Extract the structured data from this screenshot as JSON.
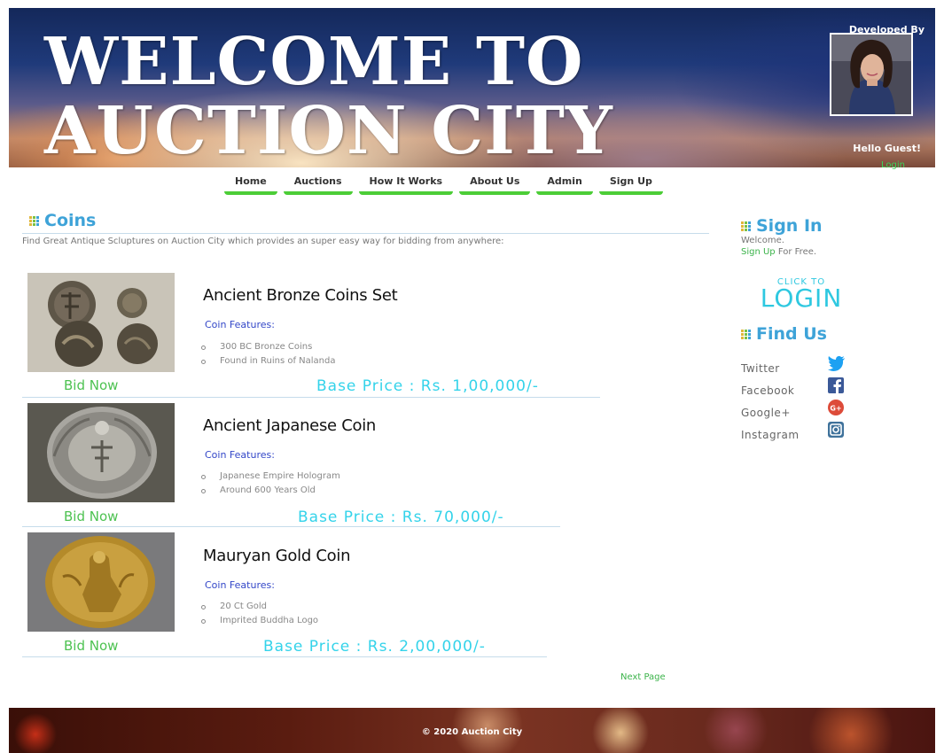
{
  "header": {
    "title_line1": "WELCOME TO",
    "title_line2": "AUCTION CITY",
    "developed_by": "Developed By",
    "greeting": "Hello Guest!",
    "login_link": "Login"
  },
  "nav": {
    "items": [
      "Home",
      "Auctions",
      "How It Works",
      "About Us",
      "Admin",
      "Sign Up"
    ]
  },
  "main": {
    "title": "Coins",
    "intro": "Find Great Antique Scluptures on Auction City which provides an super easy way for bidding from anywhere:",
    "items": [
      {
        "title": "Ancient Bronze Coins Set",
        "features_label": "Coin Features:",
        "features": [
          "300 BC Bronze Coins",
          "Found in Ruins of Nalanda"
        ],
        "bid_label": "Bid Now",
        "price": "Base Price : Rs. 1,00,000/-"
      },
      {
        "title": "Ancient Japanese Coin",
        "features_label": "Coin Features:",
        "features": [
          "Japanese Empire Hologram",
          "Around 600 Years Old"
        ],
        "bid_label": "Bid Now",
        "price": "Base Price : Rs. 70,000/-"
      },
      {
        "title": "Mauryan Gold Coin",
        "features_label": "Coin Features:",
        "features": [
          "20 Ct Gold",
          "Imprited Buddha Logo"
        ],
        "bid_label": "Bid Now",
        "price": "Base Price : Rs. 2,00,000/-"
      }
    ],
    "next_page": "Next Page"
  },
  "sidebar": {
    "signin_title": "Sign In",
    "welcome": "Welcome.",
    "signup_link": "Sign Up",
    "signup_suffix": " For Free.",
    "click_to": "CLICK TO",
    "login_big": "LOGIN",
    "findus_title": "Find Us",
    "social": [
      {
        "label": "Twitter",
        "icon": "twitter-icon",
        "color": "#1da1f2"
      },
      {
        "label": "Facebook",
        "icon": "facebook-icon",
        "color": "#3b5998"
      },
      {
        "label": "Google+",
        "icon": "google-plus-icon",
        "color": "#dd4b39"
      },
      {
        "label": "Instagram",
        "icon": "instagram-icon",
        "color": "#3f729b"
      }
    ]
  },
  "footer": {
    "copyright": "© 2020 Auction City"
  },
  "colors": {
    "accent_green": "#4ccd37",
    "title_blue": "#3ea3d8",
    "price_cyan": "#34d3ea",
    "feature_blue": "#3347c8"
  }
}
